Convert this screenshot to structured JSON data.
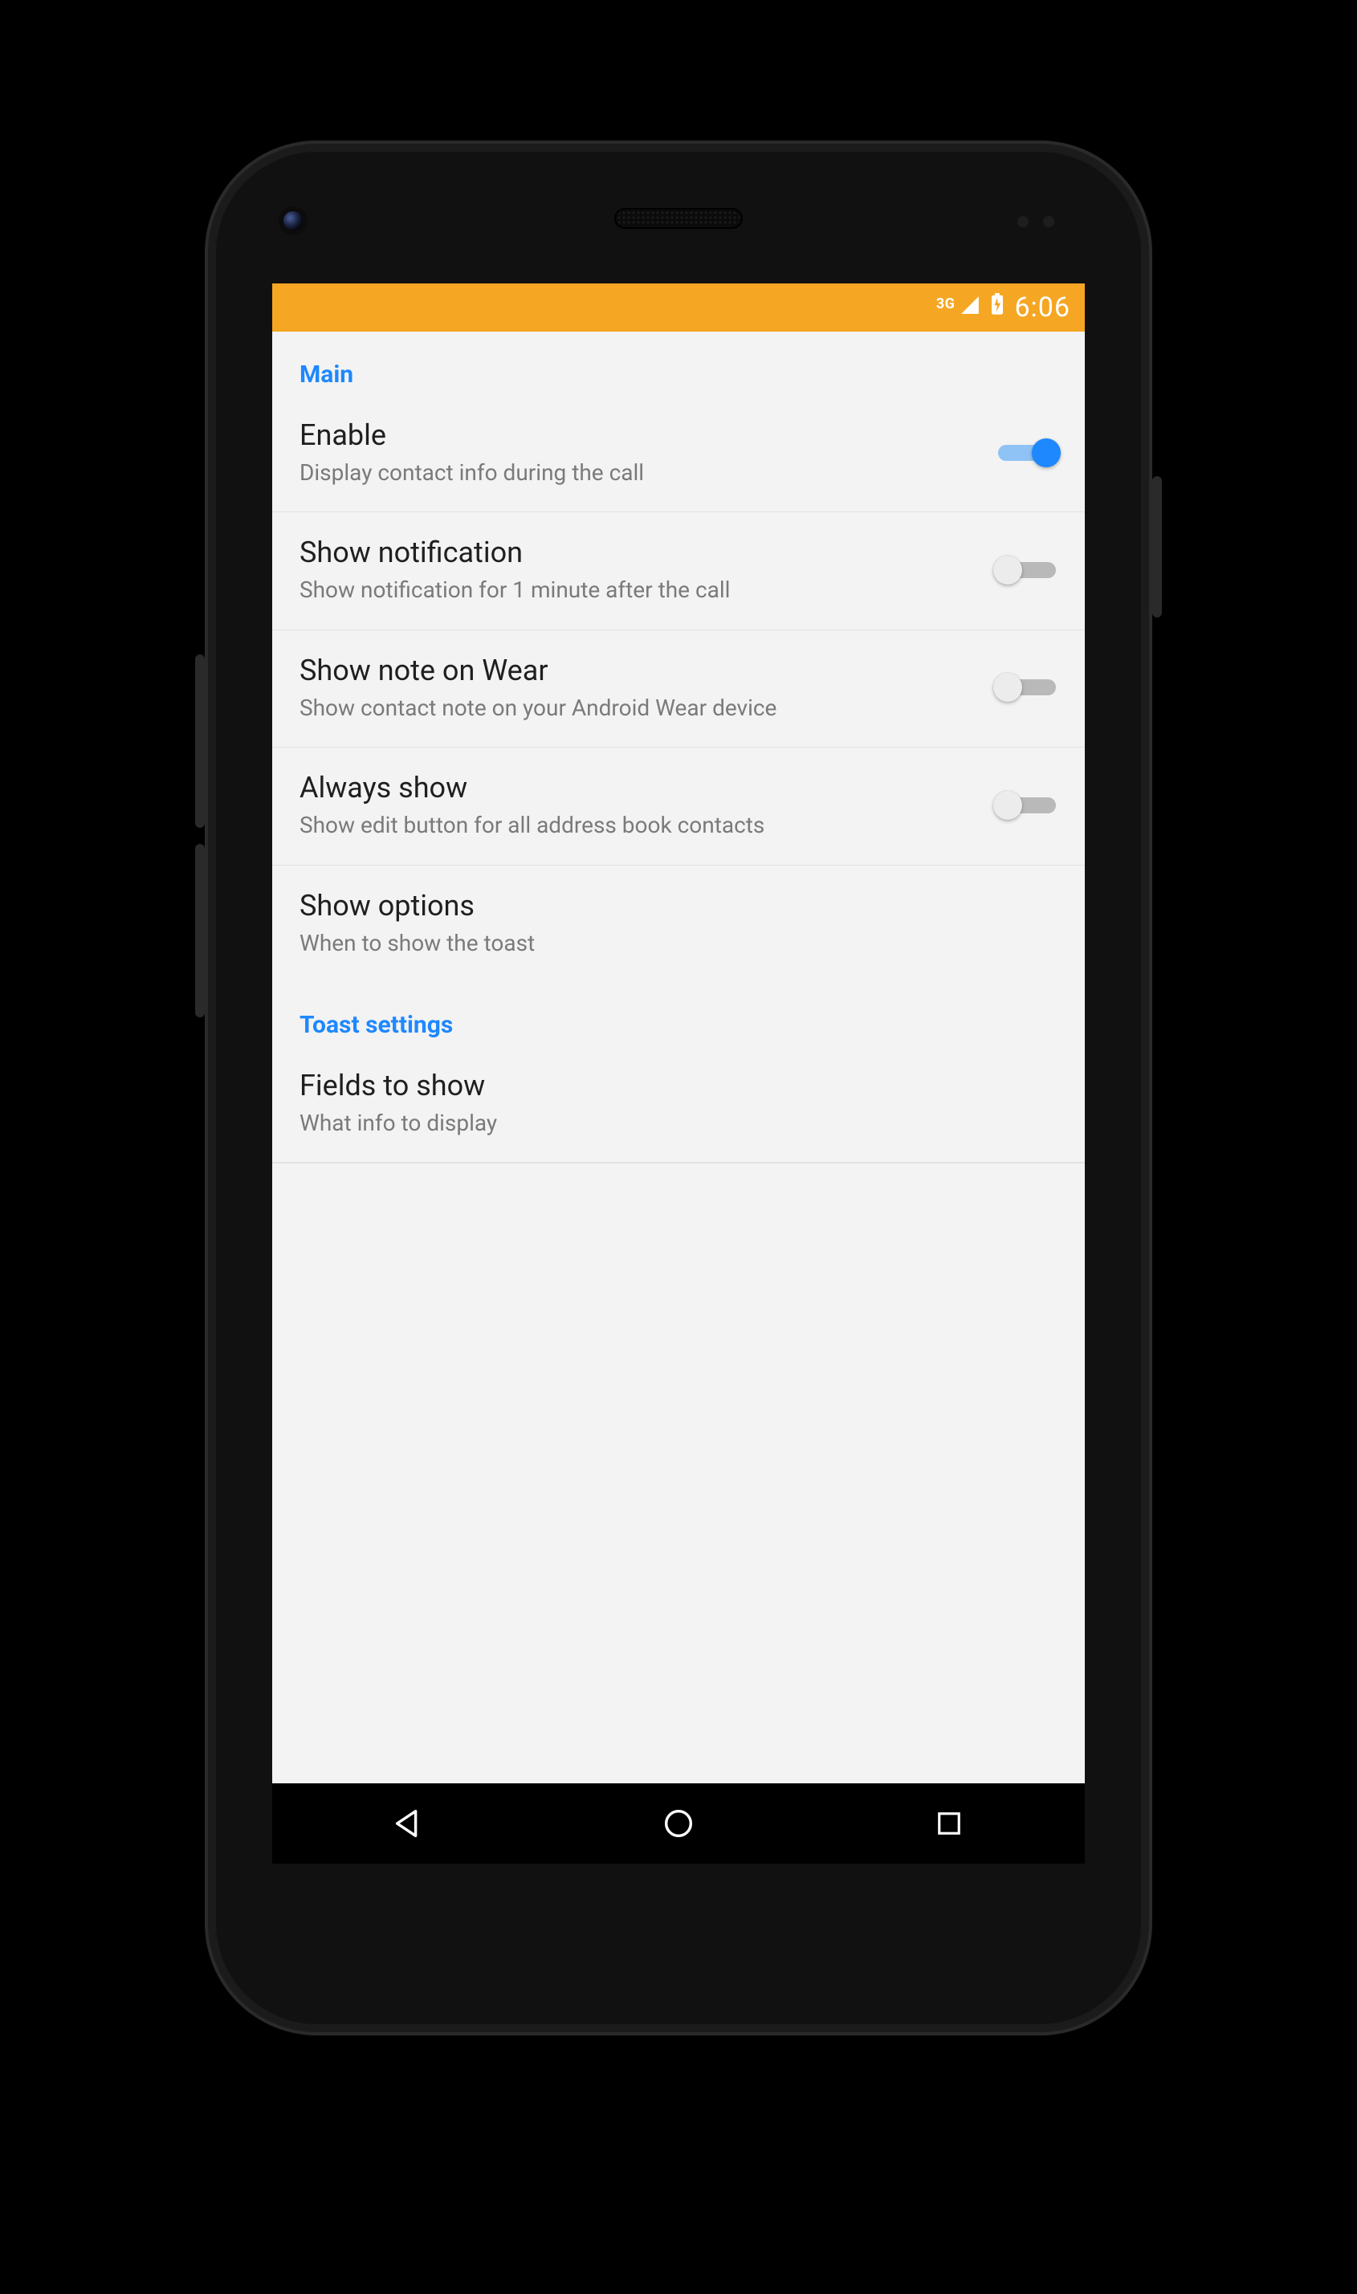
{
  "statusbar": {
    "network_label": "3G",
    "clock": "6:06"
  },
  "sections": {
    "main": {
      "header": "Main",
      "items": {
        "enable": {
          "title": "Enable",
          "subtitle": "Display contact info during the call",
          "checked": true
        },
        "show_notification": {
          "title": "Show notification",
          "subtitle": "Show notification for 1 minute after the call",
          "checked": false
        },
        "show_note_wear": {
          "title": "Show note on Wear",
          "subtitle": "Show contact note on your Android Wear device",
          "checked": false
        },
        "always_show": {
          "title": "Always show",
          "subtitle": "Show edit button for all address book contacts",
          "checked": false
        },
        "show_options": {
          "title": "Show options",
          "subtitle": "When to show the toast"
        }
      }
    },
    "toast": {
      "header": "Toast settings",
      "items": {
        "fields_to_show": {
          "title": "Fields to show",
          "subtitle": "What info to display"
        }
      }
    }
  }
}
